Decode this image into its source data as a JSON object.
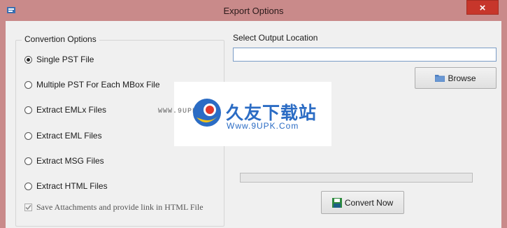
{
  "window": {
    "title": "Export Options",
    "close_label": "×"
  },
  "conversion": {
    "group_label": "Convertion Options",
    "options": [
      {
        "label": "Single PST File",
        "checked": true
      },
      {
        "label": "Multiple PST For Each MBox File",
        "checked": false
      },
      {
        "label": "Extract EMLx Files",
        "checked": false
      },
      {
        "label": "Extract EML Files",
        "checked": false
      },
      {
        "label": "Extract MSG Files",
        "checked": false
      },
      {
        "label": "Extract HTML Files",
        "checked": false
      }
    ],
    "attachments_label": "Save Attachments and provide link in HTML File",
    "attachments_checked": true
  },
  "output": {
    "label": "Select Output Location",
    "path_value": "",
    "browse_label": "Browse"
  },
  "progress": {
    "value": 0
  },
  "actions": {
    "convert_label": "Convert Now"
  },
  "watermark": {
    "small_text": "WWW.9UPK.COM",
    "brand_cn": "久友下载站",
    "url": "Www.9UPK.Com"
  },
  "colors": {
    "titlebar": "#c98a8a",
    "close_button": "#c7362b",
    "client_bg": "#f0f0f0",
    "watermark_blue": "#2b6cc4"
  },
  "icons": {
    "app": "app-icon",
    "close": "close-icon",
    "browse": "folder-icon",
    "convert": "save-icon"
  }
}
